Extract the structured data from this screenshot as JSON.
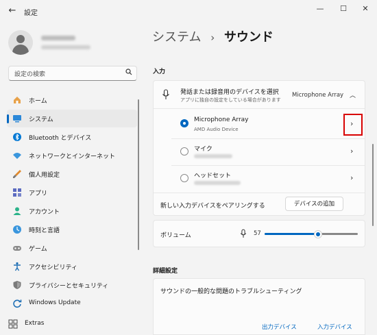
{
  "window": {
    "title": "設定",
    "back_icon": "back-arrow-icon"
  },
  "search": {
    "placeholder": "設定の検索"
  },
  "sidebar": {
    "items": [
      {
        "label": "ホーム",
        "icon": "home-icon"
      },
      {
        "label": "システム",
        "icon": "system-icon"
      },
      {
        "label": "Bluetooth とデバイス",
        "icon": "bluetooth-icon"
      },
      {
        "label": "ネットワークとインターネット",
        "icon": "wifi-icon"
      },
      {
        "label": "個人用設定",
        "icon": "brush-icon"
      },
      {
        "label": "アプリ",
        "icon": "apps-icon"
      },
      {
        "label": "アカウント",
        "icon": "account-icon"
      },
      {
        "label": "時刻と言語",
        "icon": "time-language-icon"
      },
      {
        "label": "ゲーム",
        "icon": "gamepad-icon"
      },
      {
        "label": "アクセシビリティ",
        "icon": "accessibility-icon"
      },
      {
        "label": "プライバシーとセキュリティ",
        "icon": "shield-icon"
      },
      {
        "label": "Windows Update",
        "icon": "update-icon"
      },
      {
        "label": "Extras",
        "icon": "extras-icon"
      }
    ],
    "active_index": 1
  },
  "breadcrumb": {
    "parent": "システム",
    "separator": "›",
    "current": "サウンド"
  },
  "input": {
    "section_title": "入力",
    "header": {
      "title": "発話または録音用のデバイスを選択",
      "subtitle": "アプリに独自の設定をしている場合があります",
      "value": "Microphone Array"
    },
    "devices": [
      {
        "name": "Microphone Array",
        "sub": "AMD Audio Device",
        "selected": true
      },
      {
        "name": "マイク",
        "sub": "",
        "selected": false
      },
      {
        "name": "ヘッドセット",
        "sub": "",
        "selected": false
      }
    ],
    "pair_text": "新しい入力デバイスをペアリングする",
    "add_button": "デバイスの追加",
    "volume": {
      "label": "ボリューム",
      "value": "57",
      "fraction": 0.57
    }
  },
  "advanced": {
    "section_title": "詳細設定",
    "troubleshoot": "サウンドの一般的な問題のトラブルシューティング",
    "output_link": "出力デバイス",
    "input_link": "入力デバイス"
  },
  "colors": {
    "accent": "#0067c0",
    "highlight": "#d80000"
  }
}
